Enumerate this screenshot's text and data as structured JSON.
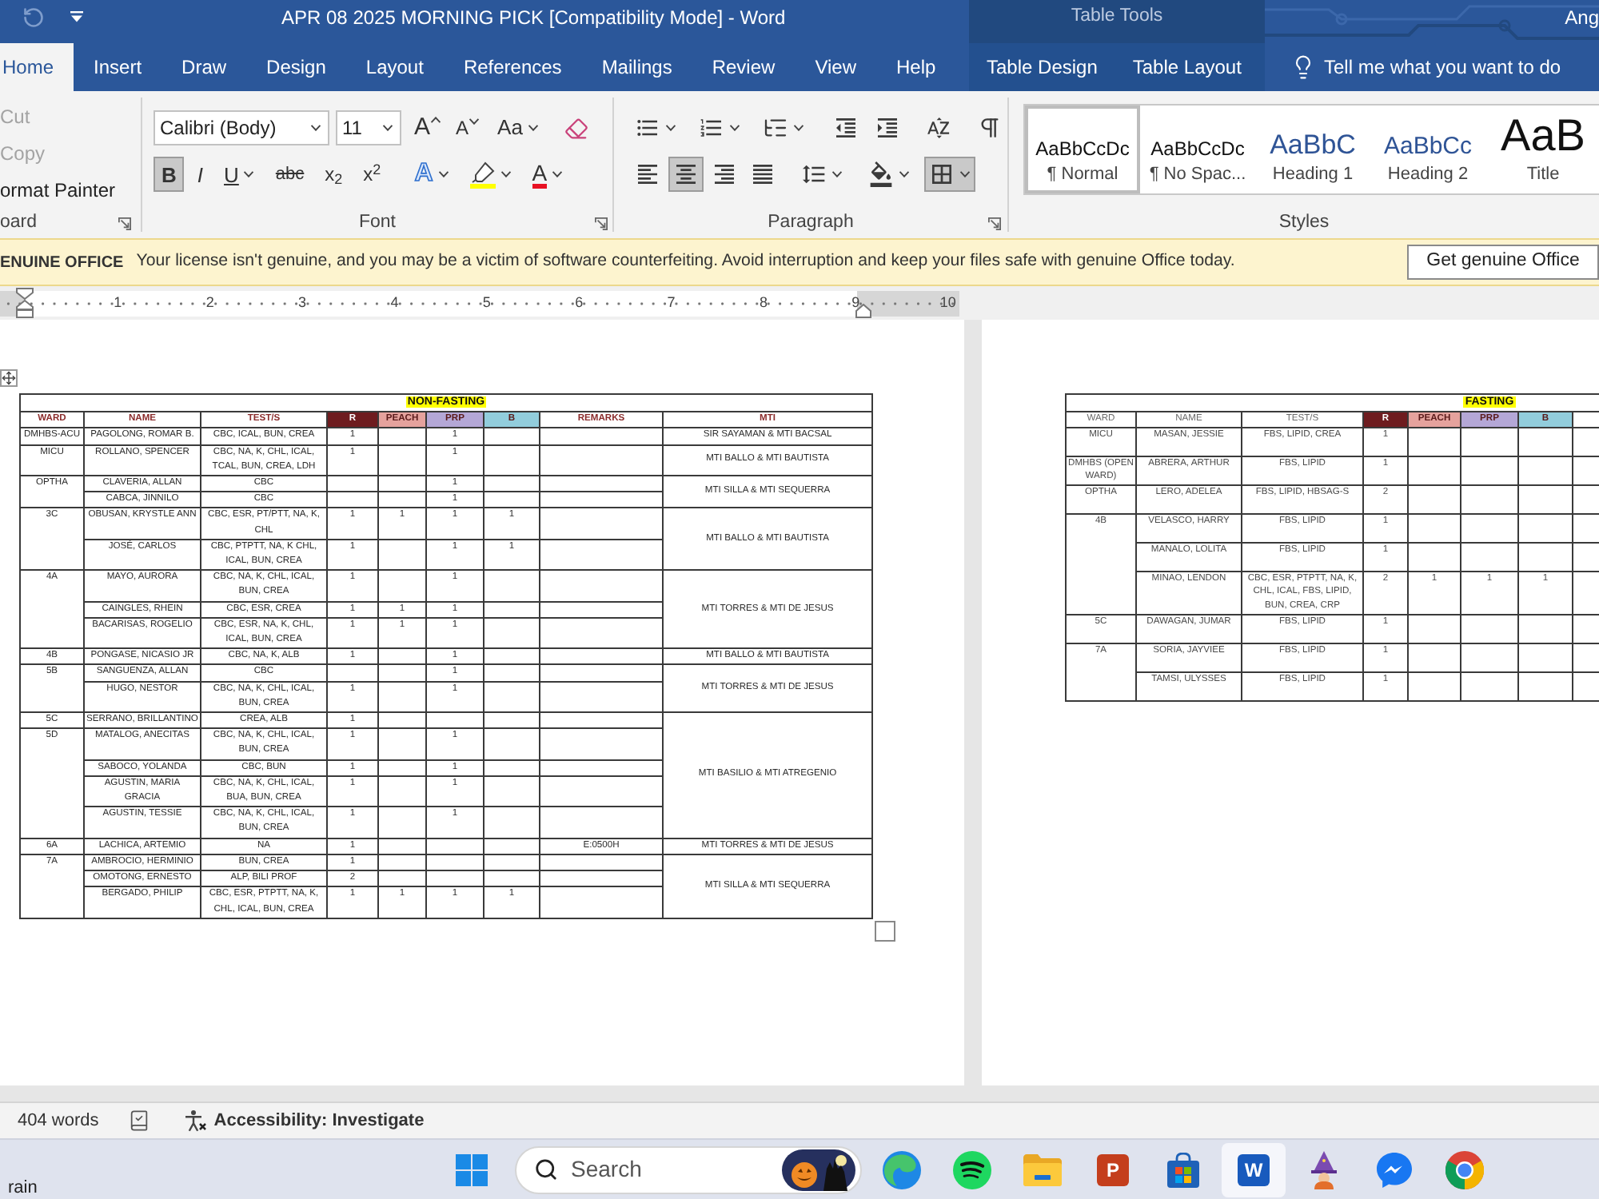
{
  "title_bar": {
    "title": "APR 08 2025 MORNING PICK [Compatibility Mode] - Word",
    "context": "Table Tools",
    "user": "Ang"
  },
  "tabs": [
    {
      "label": "Home",
      "kind": "main",
      "selected": true
    },
    {
      "label": "Insert",
      "kind": "main",
      "selected": false
    },
    {
      "label": "Draw",
      "kind": "main",
      "selected": false
    },
    {
      "label": "Design",
      "kind": "main",
      "selected": false
    },
    {
      "label": "Layout",
      "kind": "main",
      "selected": false
    },
    {
      "label": "References",
      "kind": "main",
      "selected": false
    },
    {
      "label": "Mailings",
      "kind": "main",
      "selected": false
    },
    {
      "label": "Review",
      "kind": "main",
      "selected": false
    },
    {
      "label": "View",
      "kind": "main",
      "selected": false
    },
    {
      "label": "Help",
      "kind": "main",
      "selected": false
    },
    {
      "label": "Table Design",
      "kind": "context",
      "selected": false
    },
    {
      "label": "Table Layout",
      "kind": "context",
      "selected": false
    }
  ],
  "tell_me": {
    "label": "Tell me what you want to do"
  },
  "ribbon": {
    "clipboard": {
      "items": [
        {
          "label": "Cut",
          "disabled": true
        },
        {
          "label": "Copy",
          "disabled": true
        },
        {
          "label": "ormat Painter",
          "disabled": false
        }
      ],
      "label": "oard"
    },
    "font": {
      "font_name": "Calibri (Body)",
      "font_size": "11",
      "row1": [
        {
          "kind": "grow",
          "label": "A"
        },
        {
          "kind": "shrink",
          "label": "A"
        },
        {
          "kind": "case",
          "label": "Aa"
        },
        {
          "kind": "clear"
        }
      ],
      "row2": [
        {
          "kind": "bold",
          "label": "B",
          "selected": true
        },
        {
          "kind": "italic",
          "label": "I",
          "selected": false
        },
        {
          "kind": "underline",
          "label": "U",
          "selected": false
        },
        {
          "kind": "strike",
          "label": "abc",
          "selected": false
        },
        {
          "kind": "subscript",
          "label": "x$_{2}$",
          "selected": false
        },
        {
          "kind": "superscript",
          "label": "x$^{2}$",
          "selected": false
        },
        {
          "kind": "effects",
          "label": "A",
          "selected": false
        },
        {
          "kind": "highlight",
          "selected": false
        },
        {
          "kind": "font_color",
          "label": "A",
          "selected": false
        }
      ],
      "label": "Font"
    },
    "paragraph": {
      "row1": [
        {
          "kind": "bullets",
          "selected": false
        },
        {
          "kind": "numbering",
          "selected": false
        },
        {
          "kind": "multilevel",
          "selected": false
        },
        {
          "kind": "outdent",
          "selected": false
        },
        {
          "kind": "indent",
          "selected": false
        },
        {
          "kind": "sort",
          "selected": false
        },
        {
          "kind": "marks",
          "selected": false
        }
      ],
      "row2": [
        {
          "kind": "align_left",
          "selected": false
        },
        {
          "kind": "align_center",
          "selected": true
        },
        {
          "kind": "align_right",
          "selected": false
        },
        {
          "kind": "justify",
          "selected": false
        },
        {
          "kind": "line_spacing",
          "selected": false
        },
        {
          "kind": "shading",
          "selected": false
        },
        {
          "kind": "borders",
          "selected": true
        }
      ],
      "label": "Paragraph"
    },
    "styles": {
      "items": [
        {
          "kind": "normal",
          "preview": "AaBbCcDc",
          "name": "¶ Normal",
          "selected": true
        },
        {
          "kind": "normal",
          "preview": "AaBbCcDc",
          "name": "¶ No Spac...",
          "selected": false
        },
        {
          "kind": "heading1",
          "preview": "AaBbC",
          "name": "Heading 1",
          "selected": false
        },
        {
          "kind": "heading2",
          "preview": "AaBbCc",
          "name": "Heading 2",
          "selected": false
        },
        {
          "kind": "title",
          "preview": "AaB",
          "name": "Title",
          "selected": false
        }
      ],
      "label": "Styles"
    }
  },
  "license_bar": {
    "heading": "ENUINE OFFICE",
    "message": "Your license isn't genuine, and you may be a victim of software counterfeiting. Avoid interruption and keep your files safe with genuine Office today.",
    "button": "Get genuine Office"
  },
  "ruler": {
    "numbers": [
      "1",
      "2",
      "3",
      "4",
      "5",
      "6",
      "7",
      "8",
      "9",
      "10"
    ]
  },
  "non_fasting_table": {
    "title": "NON-FASTING",
    "columns": [
      {
        "label": "WARD"
      },
      {
        "label": "NAME"
      },
      {
        "label": "TEST/S"
      },
      {
        "label": "R",
        "color": "#6e1c1f"
      },
      {
        "label": "PEACH",
        "color": "#e5a29d"
      },
      {
        "label": "PRP",
        "color": "#b4a7d6"
      },
      {
        "label": "B",
        "color": "#92cddc"
      },
      {
        "label": "REMARKS"
      },
      {
        "label": "MTI"
      }
    ],
    "blocks": [
      {
        "mti": "SIR SAYAMAN & MTI BACSAL",
        "wards": [
          {
            "ward": "DMHBS-ACU",
            "patients": [
              {
                "name": "PAGOLONG, ROMAR B.",
                "tests": "CBC, ICAL, BUN, CREA",
                "r": "1",
                "prp": "1"
              }
            ]
          }
        ]
      },
      {
        "mti": "MTI BALLO & MTI BAUTISTA",
        "wards": [
          {
            "ward": "MICU",
            "patients": [
              {
                "name": "ROLLANO, SPENCER",
                "tests": "CBC, NA, K, CHL, ICAL, TCAL, BUN, CREA, LDH",
                "r": "1",
                "prp": "1"
              }
            ]
          }
        ]
      },
      {
        "mti": "MTI SILLA & MTI SEQUERRA",
        "wards": [
          {
            "ward": "OPTHA",
            "patients": [
              {
                "name": "CLAVERIA, ALLAN",
                "tests": "CBC",
                "prp": "1"
              },
              {
                "name": "CABCA, JINNILO",
                "tests": "CBC",
                "prp": "1"
              }
            ]
          }
        ]
      },
      {
        "mti": "MTI BALLO & MTI BAUTISTA",
        "wards": [
          {
            "ward": "3C",
            "patients": [
              {
                "name": "OBUSAN, KRYSTLE ANN",
                "tests": "CBC, ESR, PT/PTT, NA, K, CHL",
                "r": "1",
                "peach": "1",
                "prp": "1",
                "b": "1"
              },
              {
                "name": "JOSÉ, CARLOS",
                "tests": "CBC, PTPTT, NA, K CHL, ICAL, BUN, CREA",
                "r": "1",
                "prp": "1",
                "b": "1"
              }
            ]
          }
        ]
      },
      {
        "mti": "MTI TORRES & MTI DE JESUS",
        "wards": [
          {
            "ward": "4A",
            "patients": [
              {
                "name": "MAYO, AURORA",
                "tests": "CBC, NA, K, CHL, ICAL, BUN, CREA",
                "r": "1",
                "prp": "1"
              },
              {
                "name": "CAINGLES, RHEIN",
                "tests": "CBC, ESR, CREA",
                "r": "1",
                "peach": "1",
                "prp": "1"
              },
              {
                "name": "BACARISAS, ROGELIO",
                "tests": "CBC, ESR, NA, K, CHL, ICAL, BUN, CREA",
                "r": "1",
                "peach": "1",
                "prp": "1"
              }
            ]
          }
        ]
      },
      {
        "mti": "MTI BALLO & MTI BAUTISTA",
        "wards": [
          {
            "ward": "4B",
            "patients": [
              {
                "name": "PONGASE, NICASIO JR",
                "tests": "CBC, NA, K, ALB",
                "r": "1",
                "prp": "1"
              }
            ]
          }
        ]
      },
      {
        "mti": "MTI TORRES & MTI DE JESUS",
        "wards": [
          {
            "ward": "5B",
            "patients": [
              {
                "name": "SANGUENZA, ALLAN",
                "tests": "CBC",
                "prp": "1"
              },
              {
                "name": "HUGO, NESTOR",
                "tests": "CBC, NA, K, CHL, ICAL, BUN, CREA",
                "r": "1",
                "prp": "1"
              }
            ]
          }
        ]
      },
      {
        "mti": "MTI BASILIO & MTI ATREGENIO",
        "wards": [
          {
            "ward": "5C",
            "patients": [
              {
                "name": "SERRANO, BRILLANTINO",
                "tests": "CREA, ALB",
                "r": "1"
              }
            ]
          },
          {
            "ward": "5D",
            "patients": [
              {
                "name": "MATALOG, ANECITAS",
                "tests": "CBC, NA, K, CHL, ICAL, BUN, CREA",
                "r": "1",
                "prp": "1"
              },
              {
                "name": "SABOCO, YOLANDA",
                "tests": "CBC, BUN",
                "r": "1",
                "prp": "1"
              },
              {
                "name": "AGUSTIN, MARIA GRACIA",
                "tests": "CBC, NA, K, CHL, ICAL, BUA, BUN, CREA",
                "r": "1",
                "prp": "1"
              },
              {
                "name": "AGUSTIN, TESSIE",
                "tests": "CBC, NA, K, CHL, ICAL, BUN, CREA",
                "r": "1",
                "prp": "1"
              }
            ]
          }
        ]
      },
      {
        "mti": "MTI TORRES & MTI DE JESUS",
        "wards": [
          {
            "ward": "6A",
            "patients": [
              {
                "name": "LACHICA, ARTEMIO",
                "tests": "NA",
                "r": "1",
                "remarks": "E:0500H"
              }
            ]
          }
        ]
      },
      {
        "mti": "MTI SILLA & MTI SEQUERRA",
        "wards": [
          {
            "ward": "7A",
            "patients": [
              {
                "name": "AMBROCIO, HERMINIO",
                "tests": "BUN, CREA",
                "r": "1"
              },
              {
                "name": "OMOTONG, ERNESTO",
                "tests": "ALP, BILI PROF",
                "r": "2"
              },
              {
                "name": "BERGADO, PHILIP",
                "tests": "CBC, ESR, PTPTT, NA, K, CHL, ICAL, BUN, CREA",
                "r": "1",
                "peach": "1",
                "prp": "1",
                "b": "1"
              }
            ]
          }
        ]
      }
    ]
  },
  "fasting_table": {
    "title": "FASTING",
    "columns": [
      {
        "label": "WARD"
      },
      {
        "label": "NAME"
      },
      {
        "label": "TEST/S"
      },
      {
        "label": "R",
        "color": "#6e1c1f"
      },
      {
        "label": "PEACH",
        "color": "#e5a29d"
      },
      {
        "label": "PRP",
        "color": "#b4a7d6"
      },
      {
        "label": "B",
        "color": "#92cddc"
      }
    ],
    "wards": [
      {
        "ward": "MICU",
        "patients": [
          {
            "name": "MASAN, JESSIE",
            "tests": "FBS, LIPID, CREA",
            "r": "1"
          }
        ]
      },
      {
        "ward": "DMHBS (OPEN WARD)",
        "patients": [
          {
            "name": "ABRERA, ARTHUR",
            "tests": "FBS, LIPID",
            "r": "1"
          }
        ]
      },
      {
        "ward": "OPTHA",
        "patients": [
          {
            "name": "LERO, ADELEA",
            "tests": "FBS, LIPID, HBSAG-S",
            "r": "2"
          }
        ]
      },
      {
        "ward": "4B",
        "patients": [
          {
            "name": "VELASCO, HARRY",
            "tests": "FBS, LIPID",
            "r": "1"
          },
          {
            "name": "MANALO, LOLITA",
            "tests": "FBS, LIPID",
            "r": "1"
          },
          {
            "name": "MINAO, LENDON",
            "tests": "CBC, ESR, PTPTT, NA, K, CHL, ICAL, FBS, LIPID, BUN, CREA, CRP",
            "r": "2",
            "peach": "1",
            "prp": "1",
            "b": "1"
          }
        ]
      },
      {
        "ward": "5C",
        "patients": [
          {
            "name": "DAWAGAN, JUMAR",
            "tests": "FBS, LIPID",
            "r": "1"
          }
        ]
      },
      {
        "ward": "7A",
        "patients": [
          {
            "name": "SORIA, JAYVIEE",
            "tests": "FBS, LIPID",
            "r": "1"
          },
          {
            "name": "TAMSI, ULYSSES",
            "tests": "FBS, LIPID",
            "r": "1"
          }
        ]
      }
    ]
  },
  "status_bar": {
    "words": "404 words",
    "accessibility": "Accessibility: Investigate"
  },
  "taskbar": {
    "weather": "rain",
    "search": {
      "label": "Search"
    },
    "apps": [
      {
        "kind": "swirl",
        "selected": false
      },
      {
        "kind": "music",
        "selected": false
      },
      {
        "kind": "folder",
        "selected": false
      },
      {
        "kind": "slides",
        "letter": "P",
        "selected": false
      },
      {
        "kind": "store",
        "selected": false
      },
      {
        "kind": "document",
        "letter": "W",
        "selected": true
      },
      {
        "kind": "wizard",
        "selected": false
      },
      {
        "kind": "chat",
        "selected": false
      },
      {
        "kind": "web",
        "selected": false
      }
    ]
  }
}
